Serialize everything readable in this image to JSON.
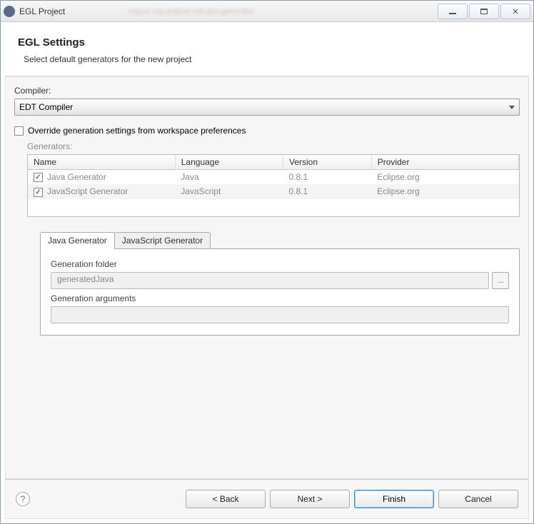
{
  "titlebar": {
    "title": "EGL Project"
  },
  "header": {
    "title": "EGL Settings",
    "subtitle": "Select default generators for the new project"
  },
  "compiler": {
    "label": "Compiler:",
    "selected": "EDT Compiler"
  },
  "override": {
    "label": "Override generation settings from workspace preferences",
    "checked": false
  },
  "generators": {
    "label": "Generators:",
    "columns": [
      "Name",
      "Language",
      "Version",
      "Provider"
    ],
    "rows": [
      {
        "checked": true,
        "name": "Java Generator",
        "language": "Java",
        "version": "0.8.1",
        "provider": "Eclipse.org"
      },
      {
        "checked": true,
        "name": "JavaScript Generator",
        "language": "JavaScript",
        "version": "0.8.1",
        "provider": "Eclipse.org"
      }
    ]
  },
  "tabs": {
    "items": [
      {
        "label": "Java Generator",
        "active": true
      },
      {
        "label": "JavaScript Generator",
        "active": false
      }
    ],
    "panel": {
      "folder_label": "Generation folder",
      "folder_value": "generatedJava",
      "browse_label": "...",
      "arguments_label": "Generation arguments",
      "arguments_value": ""
    }
  },
  "buttons": {
    "back": "< Back",
    "next": "Next >",
    "finish": "Finish",
    "cancel": "Cancel"
  }
}
